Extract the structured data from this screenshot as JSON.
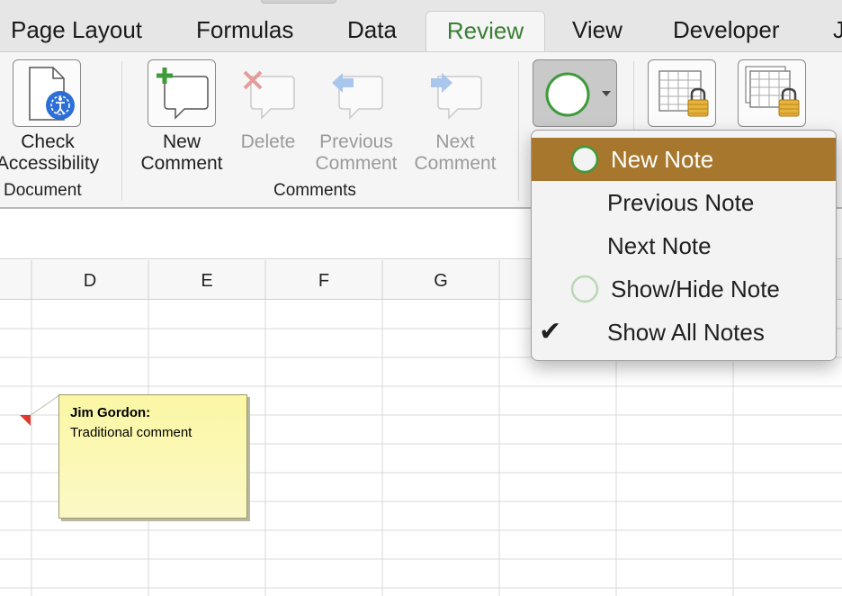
{
  "tabs": [
    {
      "label": "Page Layout",
      "active": false
    },
    {
      "label": "Formulas",
      "active": false
    },
    {
      "label": "Data",
      "active": false
    },
    {
      "label": "Review",
      "active": true
    },
    {
      "label": "View",
      "active": false
    },
    {
      "label": "Developer",
      "active": false
    },
    {
      "label": "J",
      "active": false
    }
  ],
  "ribbon": {
    "check_accessibility": {
      "line1": "Check",
      "line2": "Accessibility",
      "icon": "accessibility-icon"
    },
    "document_group": "Document",
    "new_comment": {
      "line1": "New",
      "line2": "Comment",
      "icon": "new-comment-icon",
      "enabled": true
    },
    "delete": {
      "label": "Delete",
      "icon": "delete-comment-icon",
      "enabled": false
    },
    "previous_comment": {
      "line1": "Previous",
      "line2": "Comment",
      "icon": "previous-comment-icon",
      "enabled": false
    },
    "next_comment": {
      "line1": "Next",
      "line2": "Comment",
      "icon": "next-comment-icon",
      "enabled": false
    },
    "comments_group": "Comments",
    "notes_button": {
      "icon": "note-circle-icon",
      "dropdown": "chevron-down-icon"
    },
    "protect_sheet": {
      "icon": "protect-sheet-icon"
    },
    "protect_workbook": {
      "icon": "protect-workbook-icon"
    }
  },
  "columns": [
    "D",
    "E",
    "F",
    "G"
  ],
  "comment": {
    "author": "Jim Gordon:",
    "text": "Traditional comment"
  },
  "notes_menu": [
    {
      "label": "New Note",
      "icon": "note-circle-icon",
      "highlighted": true,
      "checked": false
    },
    {
      "label": "Previous Note",
      "icon": "",
      "highlighted": false,
      "checked": false
    },
    {
      "label": "Next Note",
      "icon": "",
      "highlighted": false,
      "checked": false
    },
    {
      "label": "Show/Hide Note",
      "icon": "note-circle-icon",
      "highlighted": false,
      "checked": false
    },
    {
      "label": "Show All Notes",
      "icon": "checkmark-icon",
      "highlighted": false,
      "checked": true
    }
  ],
  "check_glyph": "✔",
  "colors": {
    "accent": "#3a7d33",
    "menu_highlight": "#a6772c",
    "note_bg": "#fbf7a4",
    "comment_marker": "#e03a2f"
  }
}
